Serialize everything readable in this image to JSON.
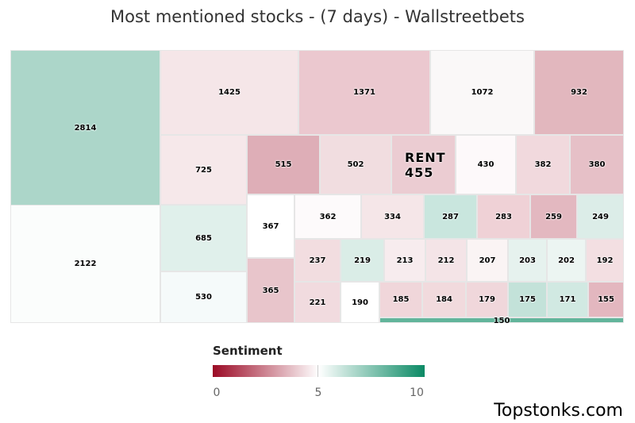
{
  "chart_data": {
    "type": "treemap",
    "title": "Most mentioned stocks - (7 days) - Wallstreetbets",
    "tiles": [
      {
        "value": 2814,
        "color": "#acd6c9"
      },
      {
        "value": 2122,
        "color": "#fbfdfc"
      },
      {
        "value": 1425,
        "color": "#f5e6e8"
      },
      {
        "value": 1371,
        "color": "#ebc8cf"
      },
      {
        "value": 1072,
        "color": "#faf8f8"
      },
      {
        "value": 932,
        "color": "#e2b7be"
      },
      {
        "value": 725,
        "color": "#f6e8ea"
      },
      {
        "value": 515,
        "color": "#deaeb7"
      },
      {
        "value": 502,
        "color": "#f1dde0"
      },
      {
        "ticker": "RENT",
        "value": 455,
        "color": "#ebccd2"
      },
      {
        "value": 430,
        "color": "#fdf9fa"
      },
      {
        "value": 382,
        "color": "#f1d9dd"
      },
      {
        "value": 380,
        "color": "#e6c0c7"
      },
      {
        "value": 685,
        "color": "#e0f0eb"
      },
      {
        "value": 530,
        "color": "#f5fafa"
      },
      {
        "value": 367,
        "color": "#ffffff"
      },
      {
        "value": 365,
        "color": "#e8c5cb"
      },
      {
        "value": 362,
        "color": "#fdfafb"
      },
      {
        "value": 334,
        "color": "#f5e6e8"
      },
      {
        "value": 287,
        "color": "#c9e6de"
      },
      {
        "value": 283,
        "color": "#efd1d6"
      },
      {
        "value": 259,
        "color": "#e3b8c0"
      },
      {
        "value": 249,
        "color": "#dcede8"
      },
      {
        "value": 237,
        "color": "#f2dde0"
      },
      {
        "value": 219,
        "color": "#daede7"
      },
      {
        "value": 213,
        "color": "#f7ecee"
      },
      {
        "value": 212,
        "color": "#f4e4e7"
      },
      {
        "value": 207,
        "color": "#faf4f4"
      },
      {
        "value": 203,
        "color": "#e6f2ee"
      },
      {
        "value": 202,
        "color": "#ecf5f2"
      },
      {
        "value": 192,
        "color": "#f3dfe2"
      },
      {
        "value": 221,
        "color": "#f1dbdf"
      },
      {
        "value": 190,
        "color": "#ffffff"
      },
      {
        "value": 185,
        "color": "#f0d6da"
      },
      {
        "value": 184,
        "color": "#f1dadd"
      },
      {
        "value": 179,
        "color": "#f0d7db"
      },
      {
        "value": 175,
        "color": "#c3e2d9"
      },
      {
        "value": 171,
        "color": "#d1e9e2"
      },
      {
        "value": 155,
        "color": "#e3b7bf"
      },
      {
        "value": 150,
        "color": "#62b59b"
      }
    ],
    "colorscale": {
      "title": "Sentiment",
      "min": 0,
      "mid": 5,
      "max": 10,
      "ticks": [
        "0",
        "5",
        "10"
      ],
      "colors": [
        "#9b0a25",
        "#ffffff",
        "#0b8a65"
      ]
    }
  },
  "credit": "Topstonks.com"
}
